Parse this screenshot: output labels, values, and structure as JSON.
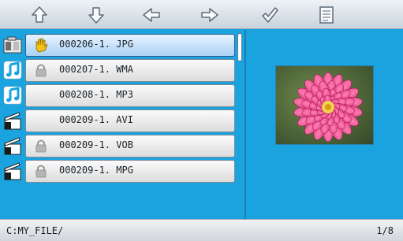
{
  "toolbar": {
    "buttons": [
      {
        "icon": "arrow-up-icon"
      },
      {
        "icon": "arrow-down-icon"
      },
      {
        "icon": "arrow-left-icon"
      },
      {
        "icon": "arrow-right-icon"
      },
      {
        "icon": "checkmark-icon"
      },
      {
        "icon": "list-icon"
      }
    ]
  },
  "files": [
    {
      "name": "000206-1. JPG",
      "type_icon": "photo-icon",
      "tag_icon": "hand-icon",
      "selected": true
    },
    {
      "name": "000207-1. WMA",
      "type_icon": "music-icon",
      "tag_icon": "lock-icon",
      "selected": false
    },
    {
      "name": "000208-1. MP3",
      "type_icon": "music-icon",
      "tag_icon": "",
      "selected": false
    },
    {
      "name": "000209-1. AVI",
      "type_icon": "clapperboard-icon",
      "tag_icon": "",
      "selected": false
    },
    {
      "name": "000209-1. VOB",
      "type_icon": "clapperboard-icon",
      "tag_icon": "lock-icon",
      "selected": false
    },
    {
      "name": "000209-1. MPG",
      "type_icon": "clapperboard-icon",
      "tag_icon": "lock-icon",
      "selected": false
    }
  ],
  "preview": {
    "subject": "pink dahlia flower photo"
  },
  "status": {
    "path": "C:MY_FILE/",
    "page": "1/8"
  },
  "colors": {
    "background": "#1aa3df",
    "selected_row": "#a9d1f5",
    "flower": "#e0266f"
  }
}
